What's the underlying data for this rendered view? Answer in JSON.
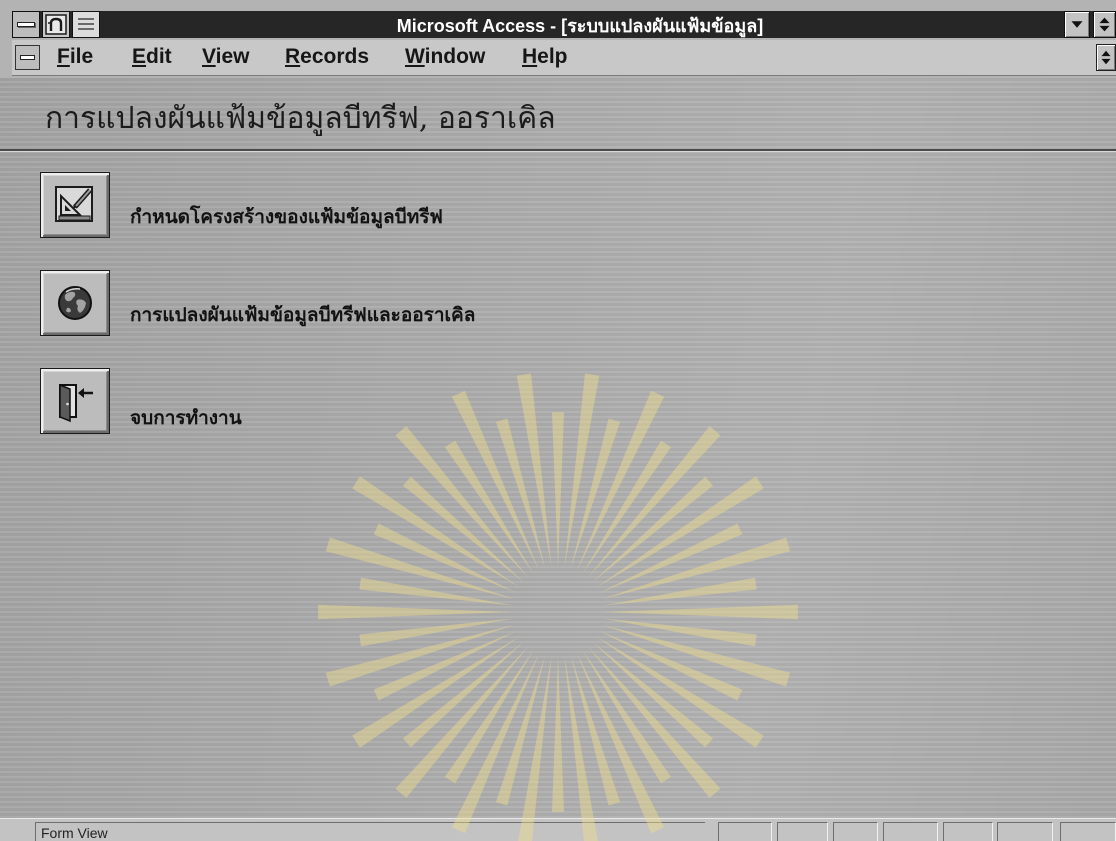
{
  "window": {
    "title": "Microsoft Access - [ระบบแปลงผันแฟ้มข้อมูล]",
    "controls": [
      "control-menu-icon",
      "access-app-icon",
      "form-menu-icon",
      "minimize-icon",
      "maximize-icon"
    ]
  },
  "menubar": {
    "items": [
      {
        "label": "File"
      },
      {
        "label": "Edit"
      },
      {
        "label": "View"
      },
      {
        "label": "Records"
      },
      {
        "label": "Window"
      },
      {
        "label": "Help"
      }
    ],
    "controls": [
      "document-control-menu-icon",
      "document-restore-icon"
    ]
  },
  "form": {
    "heading": "การแปลงผันแฟ้มข้อมูลบีทรีฟ, ออราเคิล",
    "buttons": [
      {
        "label": "กำหนดโครงสร้างของแฟ้มข้อมูลบีทรีฟ",
        "icon": "design-ruler-icon"
      },
      {
        "label": "การแปลงผันแฟ้มข้อมูลบีทรีฟและออราเคิล",
        "icon": "globe-icon"
      },
      {
        "label": "จบการทำงาน",
        "icon": "exit-door-icon"
      }
    ]
  },
  "statusbar": {
    "mode": "Form View"
  },
  "colors": {
    "title_bar": "#262626",
    "title_text": "#ffffff",
    "menu_bar": "#c8c8c8",
    "form_background": "#adadad",
    "watermark": "#f0dc8c"
  }
}
